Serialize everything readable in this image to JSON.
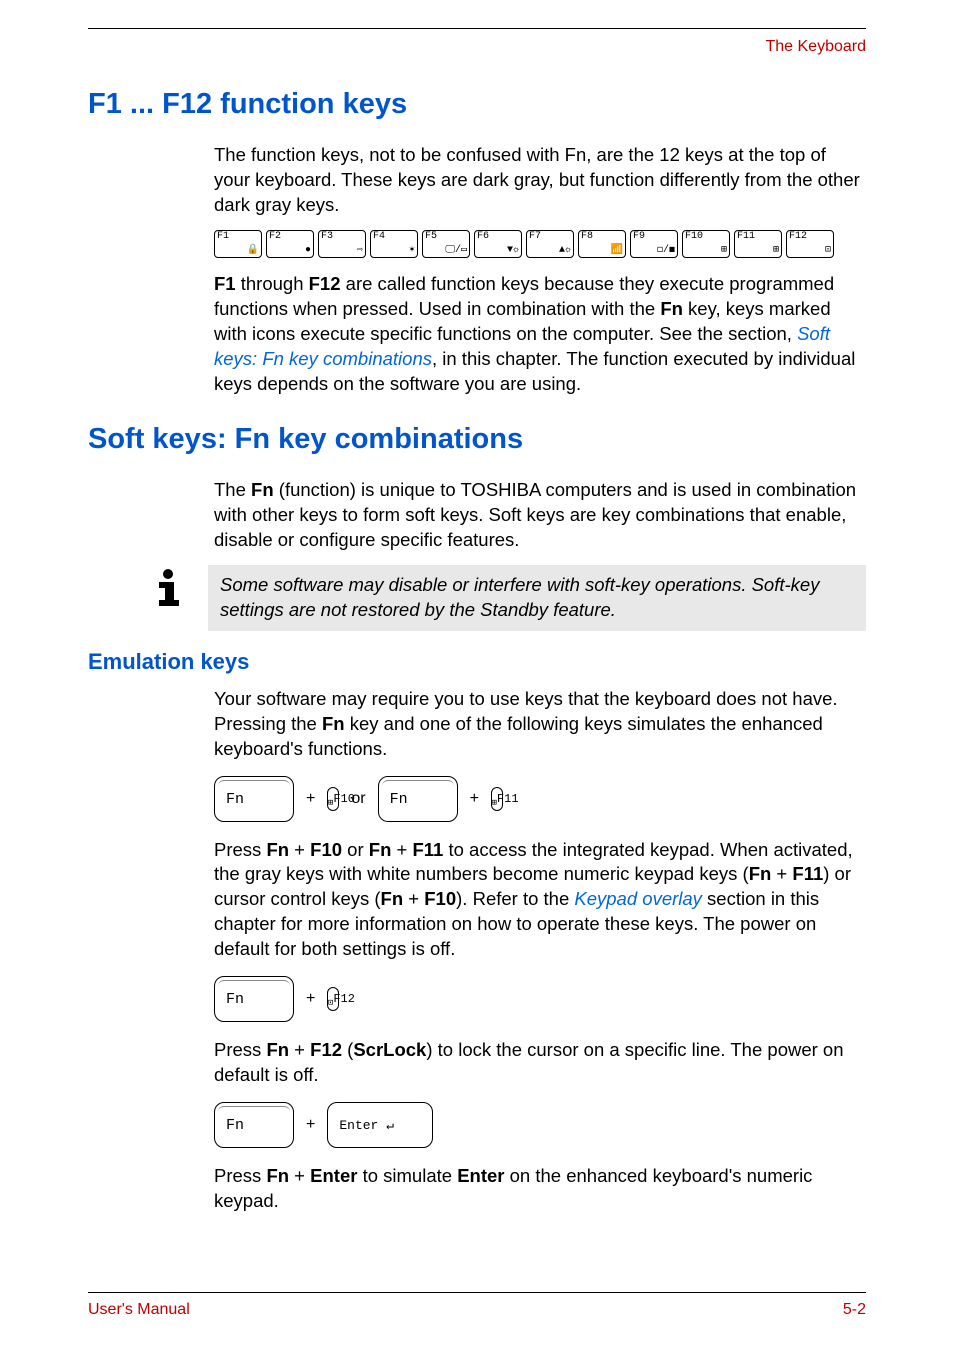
{
  "header": {
    "right": "The Keyboard"
  },
  "section1": {
    "title": "F1 ... F12 function keys",
    "para1": "The function keys, not to be confused with Fn, are the 12 keys at the top of your keyboard. These keys are dark gray, but function differently from the other dark gray keys.",
    "fkeys": [
      {
        "label": "F1",
        "glyph": "🔒"
      },
      {
        "label": "F2",
        "glyph": "●"
      },
      {
        "label": "F3",
        "glyph": "⇨"
      },
      {
        "label": "F4",
        "glyph": "✶"
      },
      {
        "label": "F5",
        "glyph": "🖵/▭"
      },
      {
        "label": "F6",
        "glyph": "▼☼"
      },
      {
        "label": "F7",
        "glyph": "▲☼"
      },
      {
        "label": "F8",
        "glyph": "📶"
      },
      {
        "label": "F9",
        "glyph": "◻/◼"
      },
      {
        "label": "F10",
        "glyph": "⊞"
      },
      {
        "label": "F11",
        "glyph": "⊞"
      },
      {
        "label": "F12",
        "glyph": "⊡"
      }
    ],
    "para2_a": "F1",
    "para2_b": " through ",
    "para2_c": "F12",
    "para2_d": " are called function keys because they execute programmed functions when pressed. Used in combination with the ",
    "para2_e": "Fn",
    "para2_f": " key, keys marked with icons execute specific functions on the computer. See the section, ",
    "para2_link": "Soft keys: Fn key combinations",
    "para2_g": ", in this chapter. The function executed by individual keys depends on the software you are using."
  },
  "section2": {
    "title": "Soft keys: Fn key combinations",
    "para1_a": "The ",
    "para1_b": "Fn",
    "para1_c": " (function) is unique to TOSHIBA computers and is used in combination with other keys to form soft keys. Soft keys are key combinations that enable, disable or configure specific features.",
    "note": "Some software may disable or interfere with soft-key operations. Soft-key settings are not restored by the Standby feature.",
    "subhead": "Emulation keys",
    "para2_a": "Your software may require you to use keys that the keyboard does not have. Pressing the ",
    "para2_b": "Fn",
    "para2_c": " key and one of the following keys simulates the enhanced keyboard's functions.",
    "combo1": {
      "k1": "Fn",
      "plus": "+",
      "k2": "F10",
      "or": "or",
      "k3": "Fn",
      "k4": "F11"
    },
    "para3_a": "Press ",
    "para3_b": "Fn",
    "para3_c": " + ",
    "para3_d": "F10",
    "para3_e": " or ",
    "para3_f": "Fn",
    "para3_g": " + ",
    "para3_h": "F11",
    "para3_i": " to access the integrated keypad. When activated, the gray keys with white numbers become numeric keypad keys (",
    "para3_j": "Fn",
    "para3_k": " + ",
    "para3_l": "F11",
    "para3_m": ") or cursor control keys (",
    "para3_n": "Fn",
    "para3_o": " + ",
    "para3_p": "F10",
    "para3_q": "). Refer to the ",
    "para3_link": "Keypad overlay",
    "para3_r": " section in this chapter for more information on how to operate these keys. The power on default for both settings is off.",
    "combo2": {
      "k1": "Fn",
      "plus": "+",
      "k2": "F12"
    },
    "para4_a": "Press ",
    "para4_b": "Fn",
    "para4_c": " + ",
    "para4_d": "F12",
    "para4_e": " (",
    "para4_f": "ScrLock",
    "para4_g": ") to lock the cursor on a specific line. The power on default is off.",
    "combo3": {
      "k1": "Fn",
      "plus": "+",
      "k2": "Enter ↵"
    },
    "para5_a": "Press ",
    "para5_b": "Fn",
    "para5_c": " + ",
    "para5_d": "Enter",
    "para5_e": " to simulate ",
    "para5_f": "Enter",
    "para5_g": " on the enhanced keyboard's numeric keypad."
  },
  "footer": {
    "left": "User's Manual",
    "right": "5-2"
  }
}
